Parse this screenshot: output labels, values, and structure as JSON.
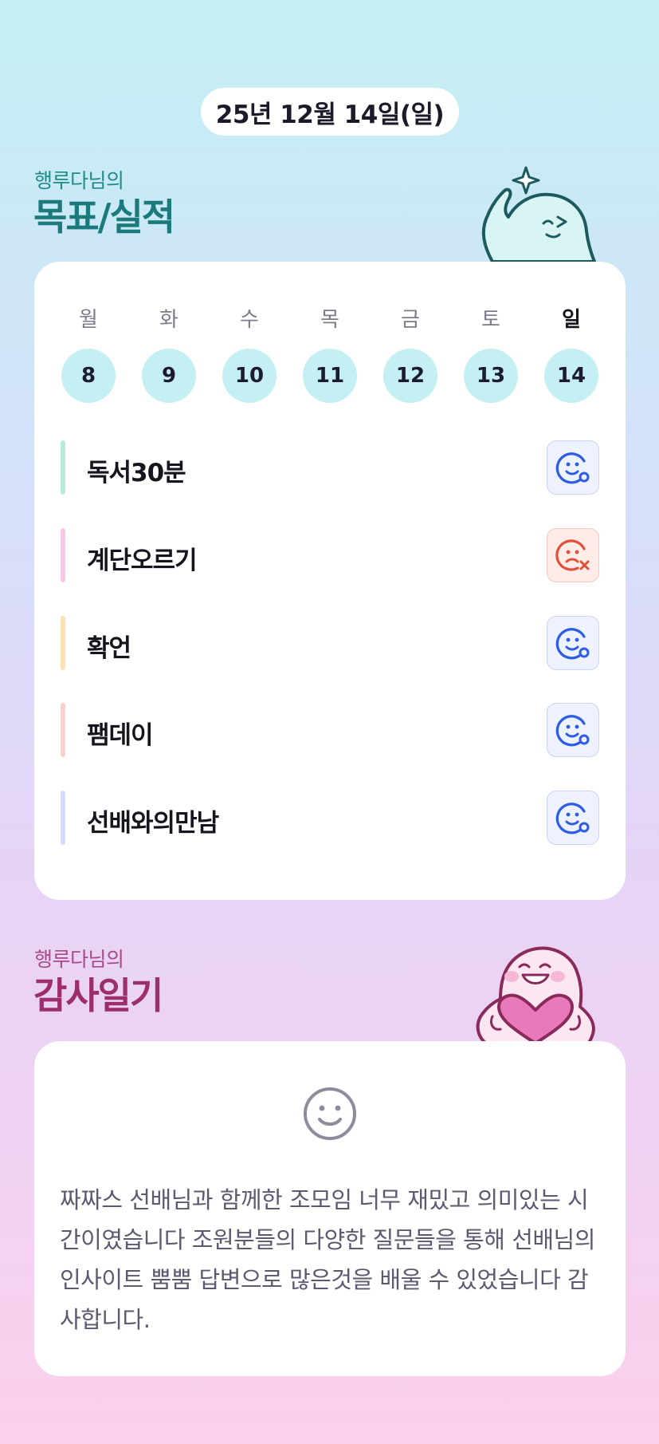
{
  "header": {
    "date": "25년 12월 14일(일)"
  },
  "goals_section": {
    "subtitle": "행루다님의",
    "title": "목표/실적",
    "weekdays": [
      {
        "label": "월",
        "day": "8",
        "active": false
      },
      {
        "label": "화",
        "day": "9",
        "active": false
      },
      {
        "label": "수",
        "day": "10",
        "active": false
      },
      {
        "label": "목",
        "day": "11",
        "active": false
      },
      {
        "label": "금",
        "day": "12",
        "active": false
      },
      {
        "label": "토",
        "day": "13",
        "active": false
      },
      {
        "label": "일",
        "day": "14",
        "active": true
      }
    ],
    "goals": [
      {
        "label": "독서30분",
        "bar_color": "#b6ecd9",
        "status": "ok",
        "icon": "smile-check-icon"
      },
      {
        "label": "계단오르기",
        "bar_color": "#f8c8e6",
        "status": "fail",
        "icon": "sad-x-icon"
      },
      {
        "label": "확언",
        "bar_color": "#fde1b6",
        "status": "ok",
        "icon": "smile-check-icon"
      },
      {
        "label": "팸데이",
        "bar_color": "#fcd0cd",
        "status": "ok",
        "icon": "smile-check-icon"
      },
      {
        "label": "선배와의만남",
        "bar_color": "#d4dbfb",
        "status": "ok",
        "icon": "smile-check-icon"
      }
    ]
  },
  "diary_section": {
    "subtitle": "행루다님의",
    "title": "감사일기",
    "mood_icon": "smile-face-icon",
    "text": "짜짜스 선배님과 함께한 조모임 너무 재밌고 의미있는 시간이였습니다 조원분들의 다양한 질문들을 통해 선배님의 인사이트 뿜뿜 답변으로 많은것을 배울 수 있었습니다 감사합니다."
  },
  "colors": {
    "ok_icon": "#2d5be3",
    "fail_icon": "#e3503a",
    "goal_title": "#1b7a7c",
    "diary_title": "#9c2e6e",
    "day_circle": "#c4eff3"
  }
}
